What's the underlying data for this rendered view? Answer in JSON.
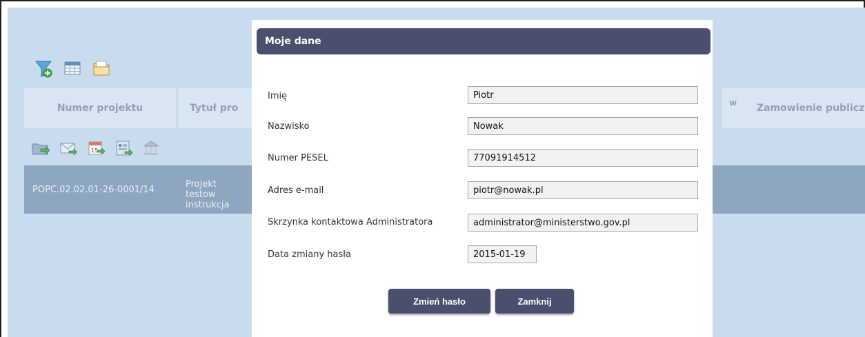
{
  "toolbar_top": {
    "icons": [
      "filter-add-icon",
      "table-icon",
      "folder-icon"
    ]
  },
  "table": {
    "headers": [
      "Numer projektu",
      "Tytuł pro",
      "w",
      "Zamowienie publiczn"
    ],
    "row": {
      "numer": "POPC.02.02.01-26-0001/14",
      "tytul": "Projekt testow instrukcja"
    }
  },
  "toolbar_actions": {
    "icons": [
      "folder-export-icon",
      "mail-icon",
      "calendar-icon",
      "report-icon",
      "bank-icon"
    ]
  },
  "modal": {
    "title": "Moje dane",
    "fields": [
      {
        "label": "Imię",
        "value": "Piotr"
      },
      {
        "label": "Nazwisko",
        "value": "Nowak"
      },
      {
        "label": "Numer PESEL",
        "value": "77091914512"
      },
      {
        "label": "Adres e-mail",
        "value": "piotr@nowak.pl"
      },
      {
        "label": "Skrzynka kontaktowa Administratora",
        "value": "administrator@ministerstwo.gov.pl"
      },
      {
        "label": "Data zmiany hasła",
        "value": "2015-01-19"
      }
    ],
    "buttons": {
      "change_password": "Zmień hasło",
      "close": "Zamknij"
    }
  },
  "colors": {
    "background": "#c9dcee",
    "header_cell": "#d9e6f2",
    "row": "#8fa6c0",
    "modal_accent": "#4a4f6e"
  }
}
